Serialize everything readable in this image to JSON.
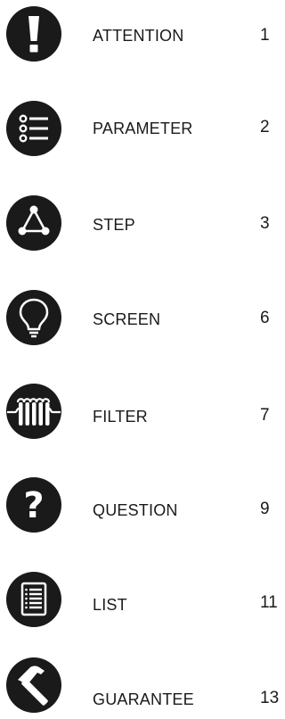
{
  "toc": {
    "items": [
      {
        "icon": "exclamation-icon",
        "label": "ATTENTION",
        "page": "1"
      },
      {
        "icon": "list-bullets-icon",
        "label": "PARAMETER",
        "page": "2"
      },
      {
        "icon": "triangle-nodes-icon",
        "label": "STEP",
        "page": "3"
      },
      {
        "icon": "lightbulb-icon",
        "label": "SCREEN",
        "page": "6"
      },
      {
        "icon": "filter-coil-icon",
        "label": "FILTER",
        "page": "7"
      },
      {
        "icon": "question-icon",
        "label": "QUESTION",
        "page": "9"
      },
      {
        "icon": "document-list-icon",
        "label": "LIST",
        "page": "11"
      },
      {
        "icon": "hammer-icon",
        "label": "GUARANTEE",
        "page": "13"
      }
    ]
  },
  "colors": {
    "icon_fill": "#1a1a1a",
    "text": "#1a1a1a",
    "background": "#ffffff"
  }
}
